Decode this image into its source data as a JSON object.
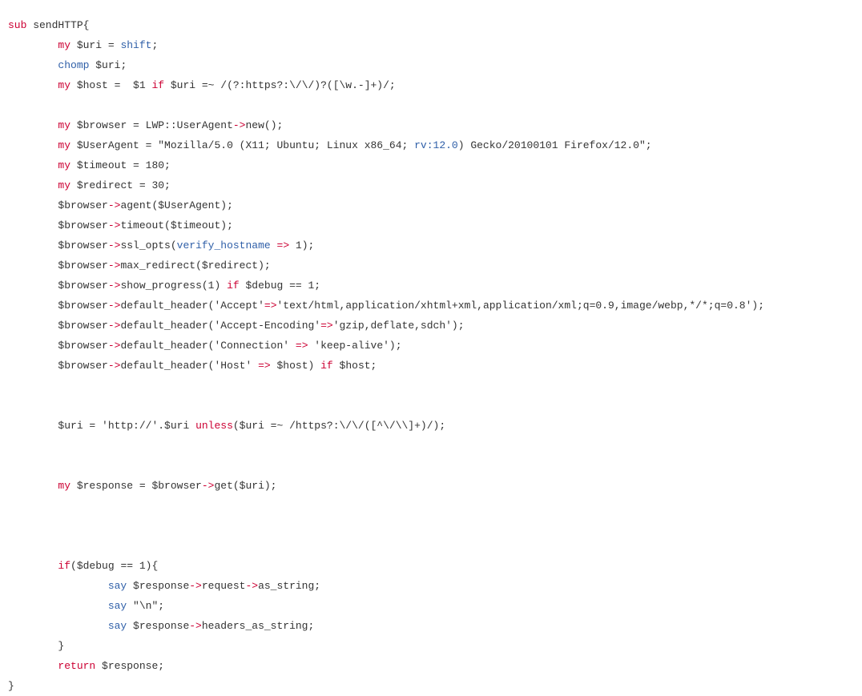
{
  "document": {
    "kind": "source-code-listing",
    "language": "Perl",
    "background_color": "#ffffff",
    "default_text_color": "#333333",
    "keyword_color": "#cc0033",
    "function_color": "#2f5fa8",
    "operator_color": "#cc0033",
    "font_size_px": 13,
    "line_height_px": 25,
    "indent_unit": "        "
  },
  "code": {
    "lines": [
      {
        "id": "line-1",
        "indent": 0,
        "tokens": [
          {
            "t": "sub",
            "c": "kw"
          },
          {
            "t": " sendHTTP{",
            "c": "plain"
          }
        ]
      },
      {
        "id": "line-2",
        "indent": 1,
        "tokens": [
          {
            "t": "my",
            "c": "kw"
          },
          {
            "t": " $uri = ",
            "c": "plain"
          },
          {
            "t": "shift",
            "c": "fn"
          },
          {
            "t": ";",
            "c": "plain"
          }
        ]
      },
      {
        "id": "line-3",
        "indent": 1,
        "tokens": [
          {
            "t": "chomp",
            "c": "fn"
          },
          {
            "t": " $uri;",
            "c": "plain"
          }
        ]
      },
      {
        "id": "line-4",
        "indent": 1,
        "tokens": [
          {
            "t": "my",
            "c": "kw"
          },
          {
            "t": " $host =  $1 ",
            "c": "plain"
          },
          {
            "t": "if",
            "c": "kw"
          },
          {
            "t": " $uri =~ /(?:https?:\\/\\/)?([\\w.-]+)/;",
            "c": "plain"
          }
        ]
      },
      {
        "id": "line-5",
        "indent": 0,
        "tokens": []
      },
      {
        "id": "line-6",
        "indent": 1,
        "tokens": [
          {
            "t": "my",
            "c": "kw"
          },
          {
            "t": " $browser = LWP::UserAgent",
            "c": "plain"
          },
          {
            "t": "->",
            "c": "op"
          },
          {
            "t": "new();",
            "c": "plain"
          }
        ]
      },
      {
        "id": "line-7",
        "indent": 1,
        "tokens": [
          {
            "t": "my",
            "c": "kw"
          },
          {
            "t": " $UserAgent = \"Mozilla/5.0 (X11; Ubuntu; Linux x86_64; ",
            "c": "plain"
          },
          {
            "t": "rv:12.0",
            "c": "fn"
          },
          {
            "t": ") Gecko/20100101 Firefox/12.0\";",
            "c": "plain"
          }
        ]
      },
      {
        "id": "line-8",
        "indent": 1,
        "tokens": [
          {
            "t": "my",
            "c": "kw"
          },
          {
            "t": " $timeout = 180;",
            "c": "plain"
          }
        ]
      },
      {
        "id": "line-9",
        "indent": 1,
        "tokens": [
          {
            "t": "my",
            "c": "kw"
          },
          {
            "t": " $redirect = 30;",
            "c": "plain"
          }
        ]
      },
      {
        "id": "line-10",
        "indent": 1,
        "tokens": [
          {
            "t": "$browser",
            "c": "plain"
          },
          {
            "t": "->",
            "c": "op"
          },
          {
            "t": "agent($UserAgent);",
            "c": "plain"
          }
        ]
      },
      {
        "id": "line-11",
        "indent": 1,
        "tokens": [
          {
            "t": "$browser",
            "c": "plain"
          },
          {
            "t": "->",
            "c": "op"
          },
          {
            "t": "timeout($timeout);",
            "c": "plain"
          }
        ]
      },
      {
        "id": "line-12",
        "indent": 1,
        "tokens": [
          {
            "t": "$browser",
            "c": "plain"
          },
          {
            "t": "->",
            "c": "op"
          },
          {
            "t": "ssl_opts(",
            "c": "plain"
          },
          {
            "t": "verify_hostname",
            "c": "fn"
          },
          {
            "t": " ",
            "c": "plain"
          },
          {
            "t": "=>",
            "c": "op"
          },
          {
            "t": " 1);",
            "c": "plain"
          }
        ]
      },
      {
        "id": "line-13",
        "indent": 1,
        "tokens": [
          {
            "t": "$browser",
            "c": "plain"
          },
          {
            "t": "->",
            "c": "op"
          },
          {
            "t": "max_redirect($redirect);",
            "c": "plain"
          }
        ]
      },
      {
        "id": "line-14",
        "indent": 1,
        "tokens": [
          {
            "t": "$browser",
            "c": "plain"
          },
          {
            "t": "->",
            "c": "op"
          },
          {
            "t": "show_progress(1) ",
            "c": "plain"
          },
          {
            "t": "if",
            "c": "kw"
          },
          {
            "t": " $debug == 1;",
            "c": "plain"
          }
        ]
      },
      {
        "id": "line-15",
        "indent": 1,
        "tokens": [
          {
            "t": "$browser",
            "c": "plain"
          },
          {
            "t": "->",
            "c": "op"
          },
          {
            "t": "default_header('Accept'",
            "c": "plain"
          },
          {
            "t": "=>",
            "c": "op"
          },
          {
            "t": "'text/html,application/xhtml+xml,application/xml;q=0.9,image/webp,*/*;q=0.8');",
            "c": "plain"
          }
        ]
      },
      {
        "id": "line-16",
        "indent": 1,
        "tokens": [
          {
            "t": "$browser",
            "c": "plain"
          },
          {
            "t": "->",
            "c": "op"
          },
          {
            "t": "default_header('Accept-Encoding'",
            "c": "plain"
          },
          {
            "t": "=>",
            "c": "op"
          },
          {
            "t": "'gzip,deflate,sdch');",
            "c": "plain"
          }
        ]
      },
      {
        "id": "line-17",
        "indent": 1,
        "tokens": [
          {
            "t": "$browser",
            "c": "plain"
          },
          {
            "t": "->",
            "c": "op"
          },
          {
            "t": "default_header('Connection' ",
            "c": "plain"
          },
          {
            "t": "=>",
            "c": "op"
          },
          {
            "t": " 'keep-alive');",
            "c": "plain"
          }
        ]
      },
      {
        "id": "line-18",
        "indent": 1,
        "tokens": [
          {
            "t": "$browser",
            "c": "plain"
          },
          {
            "t": "->",
            "c": "op"
          },
          {
            "t": "default_header('Host' ",
            "c": "plain"
          },
          {
            "t": "=>",
            "c": "op"
          },
          {
            "t": " $host) ",
            "c": "plain"
          },
          {
            "t": "if",
            "c": "kw"
          },
          {
            "t": " $host;",
            "c": "plain"
          }
        ]
      },
      {
        "id": "line-19",
        "indent": 0,
        "tokens": []
      },
      {
        "id": "line-20",
        "indent": 0,
        "tokens": []
      },
      {
        "id": "line-21",
        "indent": 1,
        "tokens": [
          {
            "t": "$uri = 'http://'.$uri ",
            "c": "plain"
          },
          {
            "t": "unless",
            "c": "kw"
          },
          {
            "t": "($uri =~ /https?:\\/\\/([^\\/\\\\]+)/);",
            "c": "plain"
          }
        ]
      },
      {
        "id": "line-22",
        "indent": 0,
        "tokens": []
      },
      {
        "id": "line-23",
        "indent": 0,
        "tokens": []
      },
      {
        "id": "line-24",
        "indent": 1,
        "tokens": [
          {
            "t": "my",
            "c": "kw"
          },
          {
            "t": " $response = $browser",
            "c": "plain"
          },
          {
            "t": "->",
            "c": "op"
          },
          {
            "t": "get($uri);",
            "c": "plain"
          }
        ]
      },
      {
        "id": "line-25",
        "indent": 0,
        "tokens": []
      },
      {
        "id": "line-26",
        "indent": 0,
        "tokens": []
      },
      {
        "id": "line-27",
        "indent": 0,
        "tokens": []
      },
      {
        "id": "line-28",
        "indent": 1,
        "tokens": [
          {
            "t": "if",
            "c": "kw"
          },
          {
            "t": "($debug == 1){",
            "c": "plain"
          }
        ]
      },
      {
        "id": "line-29",
        "indent": 2,
        "tokens": [
          {
            "t": "say",
            "c": "fn"
          },
          {
            "t": " $response",
            "c": "plain"
          },
          {
            "t": "->",
            "c": "op"
          },
          {
            "t": "request",
            "c": "plain"
          },
          {
            "t": "->",
            "c": "op"
          },
          {
            "t": "as_string;",
            "c": "plain"
          }
        ]
      },
      {
        "id": "line-30",
        "indent": 2,
        "tokens": [
          {
            "t": "say",
            "c": "fn"
          },
          {
            "t": " \"\\n\";",
            "c": "plain"
          }
        ]
      },
      {
        "id": "line-31",
        "indent": 2,
        "tokens": [
          {
            "t": "say",
            "c": "fn"
          },
          {
            "t": " $response",
            "c": "plain"
          },
          {
            "t": "->",
            "c": "op"
          },
          {
            "t": "headers_as_string;",
            "c": "plain"
          }
        ]
      },
      {
        "id": "line-32",
        "indent": 1,
        "tokens": [
          {
            "t": "}",
            "c": "plain"
          }
        ]
      },
      {
        "id": "line-33",
        "indent": 1,
        "tokens": [
          {
            "t": "return",
            "c": "kw"
          },
          {
            "t": " $response;",
            "c": "plain"
          }
        ]
      },
      {
        "id": "line-34",
        "indent": 0,
        "tokens": [
          {
            "t": "}",
            "c": "plain"
          }
        ]
      }
    ]
  }
}
